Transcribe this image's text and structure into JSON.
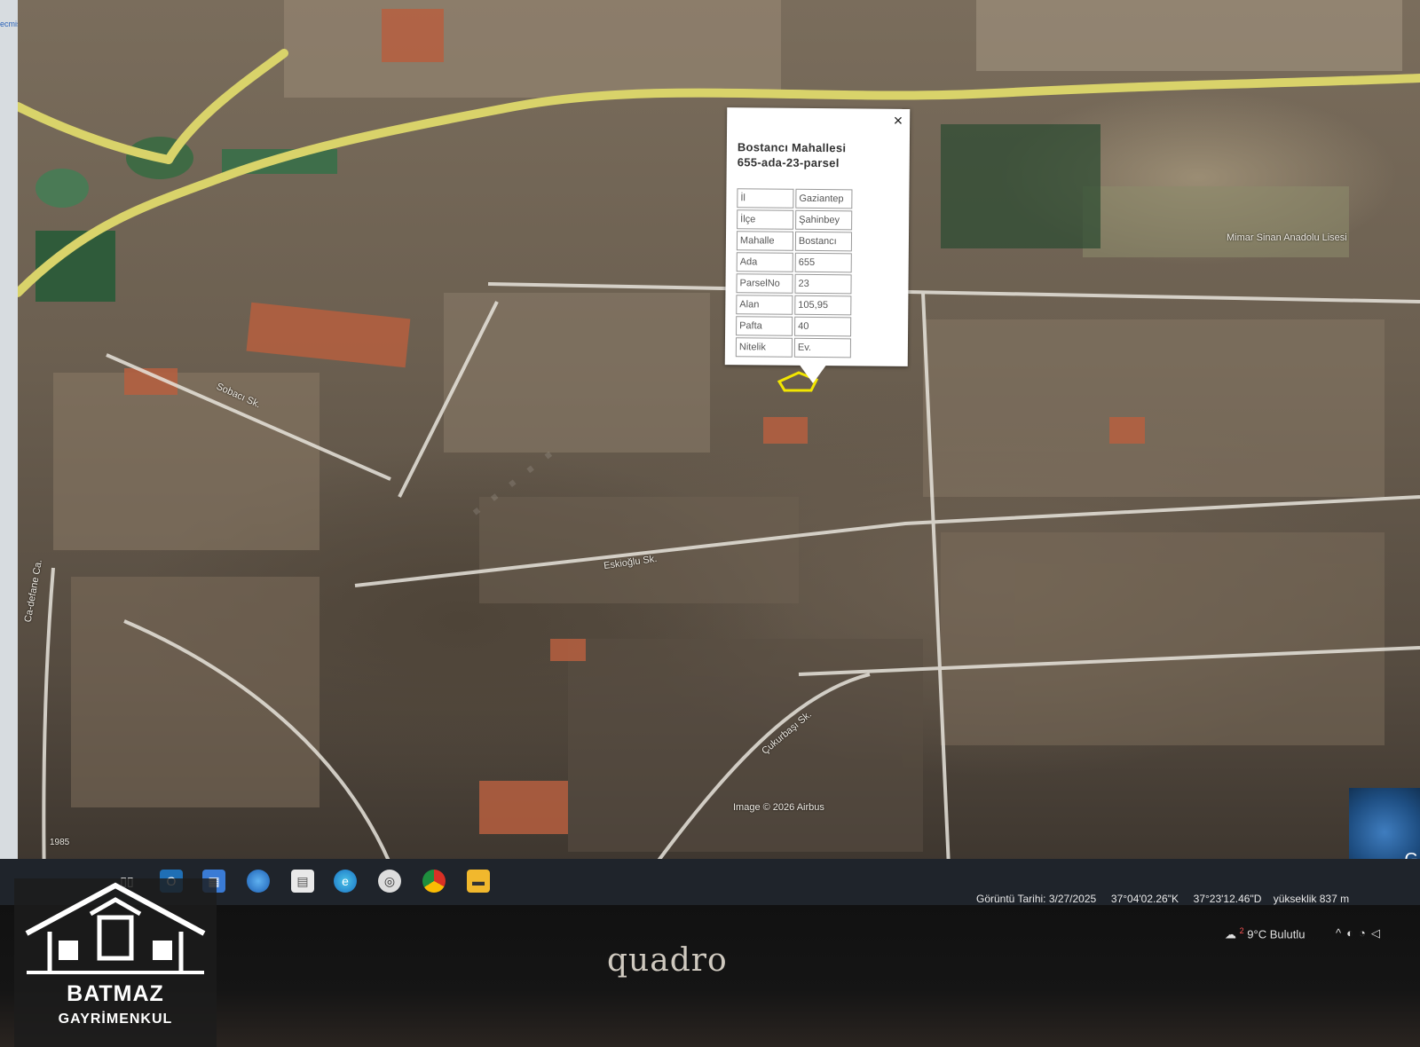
{
  "browser_strip": {
    "text": "ecmis"
  },
  "popup": {
    "title_line1": "Bostancı Mahallesi",
    "title_line2": "655-ada-23-parsel",
    "close_glyph": "×",
    "rows": [
      {
        "key": "İl",
        "value": "Gaziantep"
      },
      {
        "key": "İlçe",
        "value": "Şahinbey"
      },
      {
        "key": "Mahalle",
        "value": "Bostancı"
      },
      {
        "key": "Ada",
        "value": "655"
      },
      {
        "key": "ParselNo",
        "value": "23"
      },
      {
        "key": "Alan",
        "value": "105,95"
      },
      {
        "key": "Pafta",
        "value": "40"
      },
      {
        "key": "Nitelik",
        "value": "Ev."
      }
    ]
  },
  "map_labels": {
    "school": "Mimar Sinan Anadolu Lisesi",
    "street1": "Sobacı Sk.",
    "street2": "Eskioğlu Sk.",
    "street3": "Çukurbaşı Sk.",
    "street4": "Ca-defane Ca.",
    "copyright": "Image © 2026 Airbus",
    "year": "1985",
    "google": "G"
  },
  "status_bar": {
    "date": "Görüntü Tarihi: 3/27/2025",
    "lat": "37°04'02.26\"K",
    "lon": "37°23'12.46\"D",
    "elevation": "yükseklik   837 m"
  },
  "weather": {
    "badge": "2",
    "text": "9°C Bulutlu"
  },
  "monitor_brand": "quadro",
  "logo": {
    "name": "BATMAZ",
    "sub": "GAYRİMENKUL"
  },
  "colors": {
    "parcel_outline": "#f2e600",
    "taskbar": "#1f242b",
    "road": "#d9d36a"
  }
}
